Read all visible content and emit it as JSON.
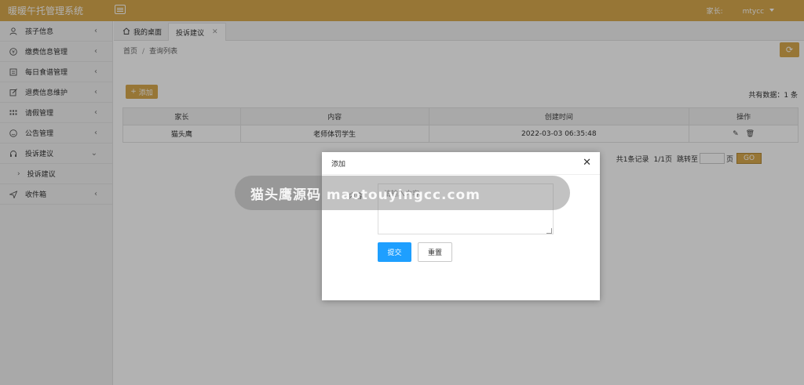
{
  "app": {
    "title": "暖暖午托管理系统"
  },
  "header": {
    "user_label": "家长:",
    "username": "mtycc"
  },
  "sidebar": {
    "items": [
      {
        "label": "孩子信息",
        "icon": "user-icon"
      },
      {
        "label": "缴费信息管理",
        "icon": "yen-icon"
      },
      {
        "label": "每日食谱管理",
        "icon": "list-icon"
      },
      {
        "label": "退费信息维护",
        "icon": "edit-icon"
      },
      {
        "label": "请假管理",
        "icon": "grid-icon"
      },
      {
        "label": "公告管理",
        "icon": "smile-icon"
      },
      {
        "label": "投诉建议",
        "icon": "headset-icon"
      },
      {
        "label": "收件箱",
        "icon": "send-icon"
      }
    ],
    "sub_items": [
      {
        "label": "投诉建议"
      }
    ]
  },
  "tabs": {
    "home": "我的桌面",
    "active": "投诉建议"
  },
  "breadcrumb": {
    "home": "首页",
    "sep": "/",
    "current": "查询列表"
  },
  "toolbar": {
    "add_label": "添加",
    "total_text": "共有数据：1 条"
  },
  "table": {
    "headers": [
      "家长",
      "内容",
      "创建时间",
      "操作"
    ],
    "rows": [
      {
        "parent": "猫头鹰",
        "content": "老师体罚学生",
        "created": "2022-03-03 06:35:48"
      }
    ]
  },
  "pager": {
    "summary": "共1条记录",
    "pages": "1/1页",
    "jump": "跳转至",
    "page_unit": "页",
    "go": "GO"
  },
  "modal": {
    "title": "添加",
    "content_label": "内容:",
    "content_placeholder": "请输入内容",
    "submit": "提交",
    "reset": "重置"
  },
  "watermark": {
    "pill_text": "猫头鹰源码 maotouyingcc.com"
  },
  "colors": {
    "brand": "#d9a94e",
    "primary": "#1e9fff"
  }
}
